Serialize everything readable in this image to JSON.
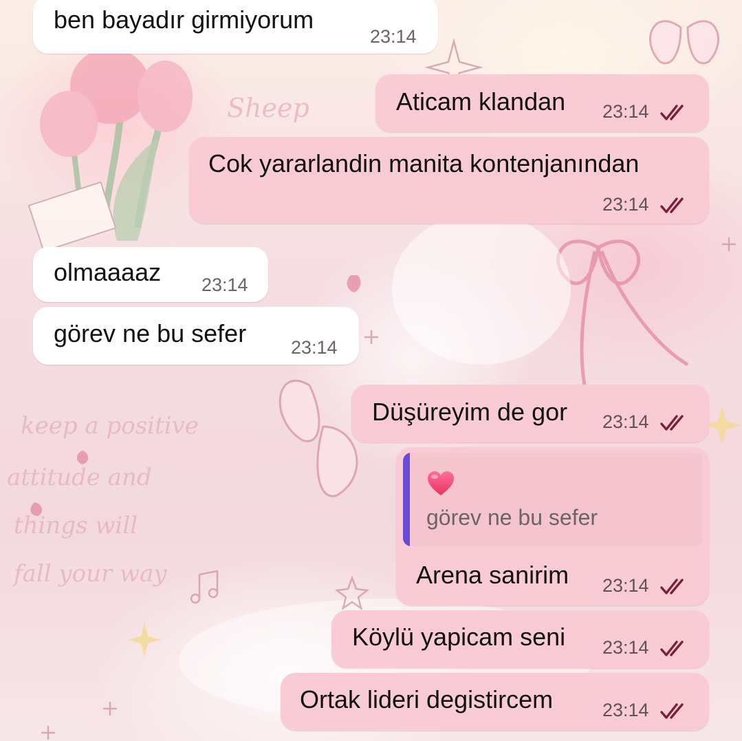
{
  "colors": {
    "incoming_bubble": "#ffffff",
    "outgoing_bubble": "#f9cbd5",
    "read_ticks": "#7a2036",
    "reply_bar": "#6a4bd6",
    "reply_background": "#f4c5cf"
  },
  "messages": [
    {
      "direction": "in",
      "text": "ben bayadır girmiyorum",
      "time": "23:14"
    },
    {
      "direction": "out",
      "text": "Aticam klandan",
      "time": "23:14",
      "status": "read"
    },
    {
      "direction": "out",
      "text": "Cok yararlandin manita kontenjanından",
      "time": "23:14",
      "status": "read"
    },
    {
      "direction": "in",
      "text": "olmaaaaz",
      "time": "23:14"
    },
    {
      "direction": "in",
      "text": "görev ne bu sefer",
      "time": "23:14"
    },
    {
      "direction": "out",
      "text": "Düşüreyim de gor",
      "time": "23:14",
      "status": "read"
    },
    {
      "direction": "out",
      "text": "Arena sanirim",
      "time": "23:14",
      "status": "read",
      "reply_to": {
        "emoji": "heart-emoji",
        "text": "görev ne bu sefer"
      }
    },
    {
      "direction": "out",
      "text": "Köylü yapicam seni",
      "time": "23:14",
      "status": "read"
    },
    {
      "direction": "out",
      "text": "Ortak lideri degistircem",
      "time": "23:14",
      "status": "read"
    }
  ]
}
